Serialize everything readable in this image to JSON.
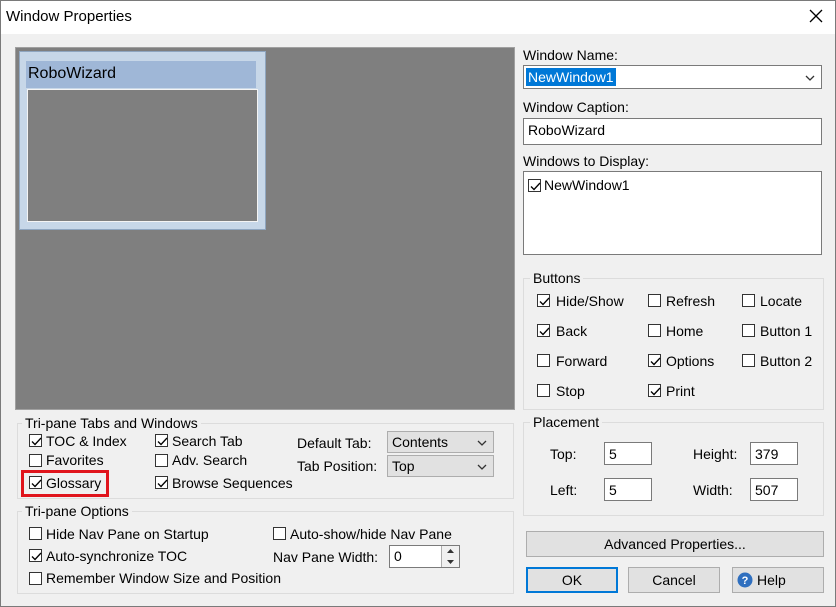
{
  "window": {
    "title": "Window Properties"
  },
  "preview": {
    "caption": "RoboWizard"
  },
  "window_name": {
    "label": "Window Name:",
    "value": "NewWindow1"
  },
  "window_caption": {
    "label": "Window Caption:",
    "value": "RoboWizard"
  },
  "windows_to_display": {
    "label": "Windows to Display:",
    "items": [
      {
        "label": "NewWindow1",
        "checked": true
      }
    ]
  },
  "buttons_group": {
    "title": "Buttons",
    "items": [
      {
        "label": "Hide/Show",
        "checked": true
      },
      {
        "label": "Refresh",
        "checked": false
      },
      {
        "label": "Locate",
        "checked": false
      },
      {
        "label": "Back",
        "checked": true
      },
      {
        "label": "Home",
        "checked": false
      },
      {
        "label": "Button 1",
        "checked": false
      },
      {
        "label": "Forward",
        "checked": false
      },
      {
        "label": "Options",
        "checked": true
      },
      {
        "label": "Button 2",
        "checked": false
      },
      {
        "label": "Stop",
        "checked": false
      },
      {
        "label": "Print",
        "checked": true
      }
    ]
  },
  "tabs_group": {
    "title": "Tri-pane Tabs and Windows",
    "items": [
      {
        "label": "TOC & Index",
        "checked": true
      },
      {
        "label": "Search Tab",
        "checked": true
      },
      {
        "label": "Favorites",
        "checked": false
      },
      {
        "label": "Adv. Search",
        "checked": false
      },
      {
        "label": "Glossary",
        "checked": true
      },
      {
        "label": "Browse Sequences",
        "checked": true
      }
    ],
    "default_tab_label": "Default Tab:",
    "default_tab_value": "Contents",
    "tab_position_label": "Tab Position:",
    "tab_position_value": "Top"
  },
  "options_group": {
    "title": "Tri-pane Options",
    "items": [
      {
        "label": "Hide Nav Pane on Startup",
        "checked": false
      },
      {
        "label": "Auto-show/hide Nav Pane",
        "checked": false
      },
      {
        "label": "Auto-synchronize TOC",
        "checked": true
      },
      {
        "label": "Remember Window Size and Position",
        "checked": false
      }
    ],
    "nav_width_label": "Nav Pane Width:",
    "nav_width_value": "0"
  },
  "placement": {
    "title": "Placement",
    "top_label": "Top:",
    "top_value": "5",
    "height_label": "Height:",
    "height_value": "379",
    "left_label": "Left:",
    "left_value": "5",
    "width_label": "Width:",
    "width_value": "507"
  },
  "actions": {
    "advanced": "Advanced Properties...",
    "ok": "OK",
    "cancel": "Cancel",
    "help": "Help"
  },
  "colors": {
    "accent": "#0078d7",
    "highlight": "#e0141c",
    "preview_bg": "#7f7f7f",
    "selection": "#0078d7"
  }
}
